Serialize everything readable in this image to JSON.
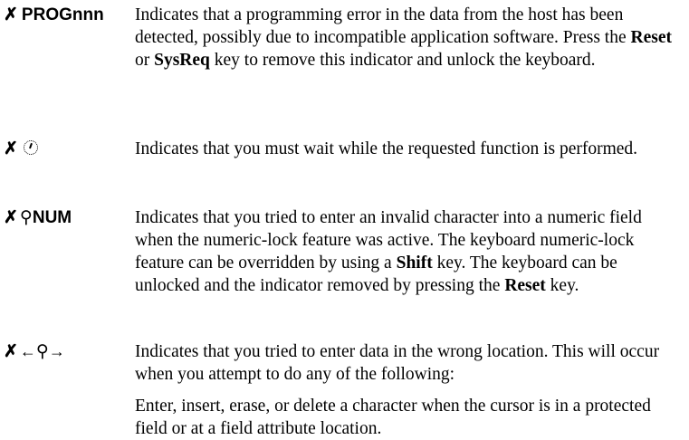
{
  "entries": [
    {
      "indicator": "PROGnnn",
      "parts": [
        "Indicates that a programming error in the data from the host has been detected, possibly due to incompatible application software. Press the ",
        "Reset",
        " or ",
        "SysReq",
        " key to remove this indicator and unlock the keyboard."
      ]
    },
    {
      "indicator": "",
      "parts": [
        "Indicates that you must wait while the requested function is performed."
      ]
    },
    {
      "indicator": "NUM",
      "parts": [
        "Indicates that you tried to enter an invalid character into a numeric field when the numeric-lock feature was active. The keyboard numeric-lock feature can be overridden by using a ",
        "Shift",
        " key. The keyboard can be unlocked and the indicator removed by pressing the ",
        "Reset",
        " key."
      ]
    },
    {
      "indicator": "",
      "paragraphs": [
        "Indicates that you tried to enter data in the wrong location. This will occur when you attempt to do any of the following:",
        "Enter, insert, erase, or delete a character when the cursor is in a protected field or at a field attribute location."
      ]
    }
  ],
  "icons": {
    "input_inhibited": "x-mark-icon",
    "wait": "clock-icon",
    "operator": "stick-figure-icon",
    "left": "left-arrow-icon",
    "right": "right-arrow-icon"
  }
}
